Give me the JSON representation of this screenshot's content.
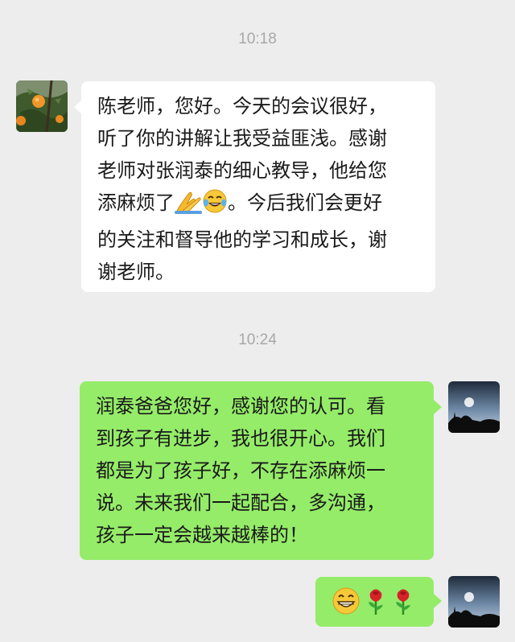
{
  "chat": {
    "timestamps": [
      "10:18",
      "10:24"
    ],
    "messages": [
      {
        "sender": "other",
        "avatar": "orange-tree-avatar",
        "lines": [
          "陈老师，您好。今天的会议很好，",
          "听了你的讲解让我受益匪浅。感谢",
          "老师对张润泰的细心教导，他给您",
          "添麻烦了",
          "。今后我们会更好",
          "的关注和督导他的学习和成长，谢",
          "谢老师。"
        ],
        "emoji": [
          "folded-hands-icon",
          "tears-of-joy-icon"
        ]
      },
      {
        "sender": "self",
        "avatar": "sky-silhouette-avatar",
        "lines": [
          "润泰爸爸您好，感谢您的认可。看",
          "到孩子有进步，我也很开心。我们",
          "都是为了孩子好，不存在添麻烦一",
          "说。未来我们一起配合，多沟通，",
          "孩子一定会越来越棒的！"
        ]
      },
      {
        "sender": "self",
        "avatar": "sky-silhouette-avatar",
        "emoji": [
          "grinning-face-icon",
          "rose-icon",
          "rose-icon"
        ]
      }
    ]
  },
  "colors": {
    "background": "#ededed",
    "incoming_bubble": "#ffffff",
    "outgoing_bubble": "#95ec69",
    "timestamp_text": "#a8a8a8"
  }
}
